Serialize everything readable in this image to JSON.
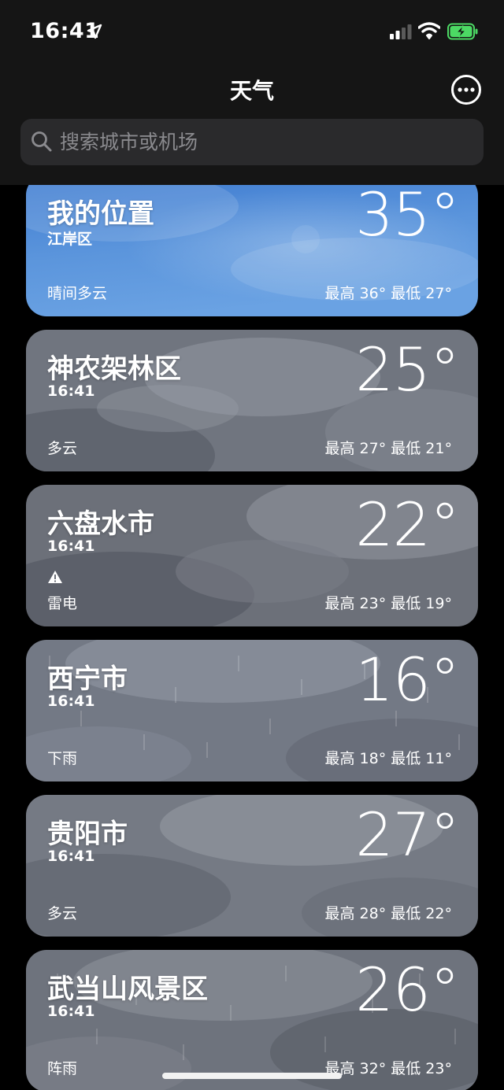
{
  "status": {
    "time": "16:41"
  },
  "nav": {
    "title": "天气"
  },
  "search": {
    "placeholder": "搜索城市或机场"
  },
  "cards": [
    {
      "city": "我的位置",
      "sub": "江岸区",
      "temp": "35°",
      "condition": "晴间多云",
      "hilo": "最高 36°  最低 27°",
      "theme": "sunny",
      "alert": false
    },
    {
      "city": "神农架林区",
      "sub": "16:41",
      "temp": "25°",
      "condition": "多云",
      "hilo": "最高 27°  最低 21°",
      "theme": "cloudy",
      "alert": false
    },
    {
      "city": "六盘水市",
      "sub": "16:41",
      "temp": "22°",
      "condition": "雷电",
      "hilo": "最高 23°  最低 19°",
      "theme": "cloudy",
      "alert": true
    },
    {
      "city": "西宁市",
      "sub": "16:41",
      "temp": "16°",
      "condition": "下雨",
      "hilo": "最高 18°  最低 11°",
      "theme": "rain",
      "alert": false
    },
    {
      "city": "贵阳市",
      "sub": "16:41",
      "temp": "27°",
      "condition": "多云",
      "hilo": "最高 28°  最低 22°",
      "theme": "cloudy",
      "alert": false
    },
    {
      "city": "武当山风景区",
      "sub": "16:41",
      "temp": "26°",
      "condition": "阵雨",
      "hilo": "最高 32°  最低 23°",
      "theme": "rain",
      "alert": false
    }
  ],
  "colors": {
    "battery": "#4cd964",
    "sunny_top": "#4a86d6",
    "cloud_grey": "#6f7480"
  }
}
